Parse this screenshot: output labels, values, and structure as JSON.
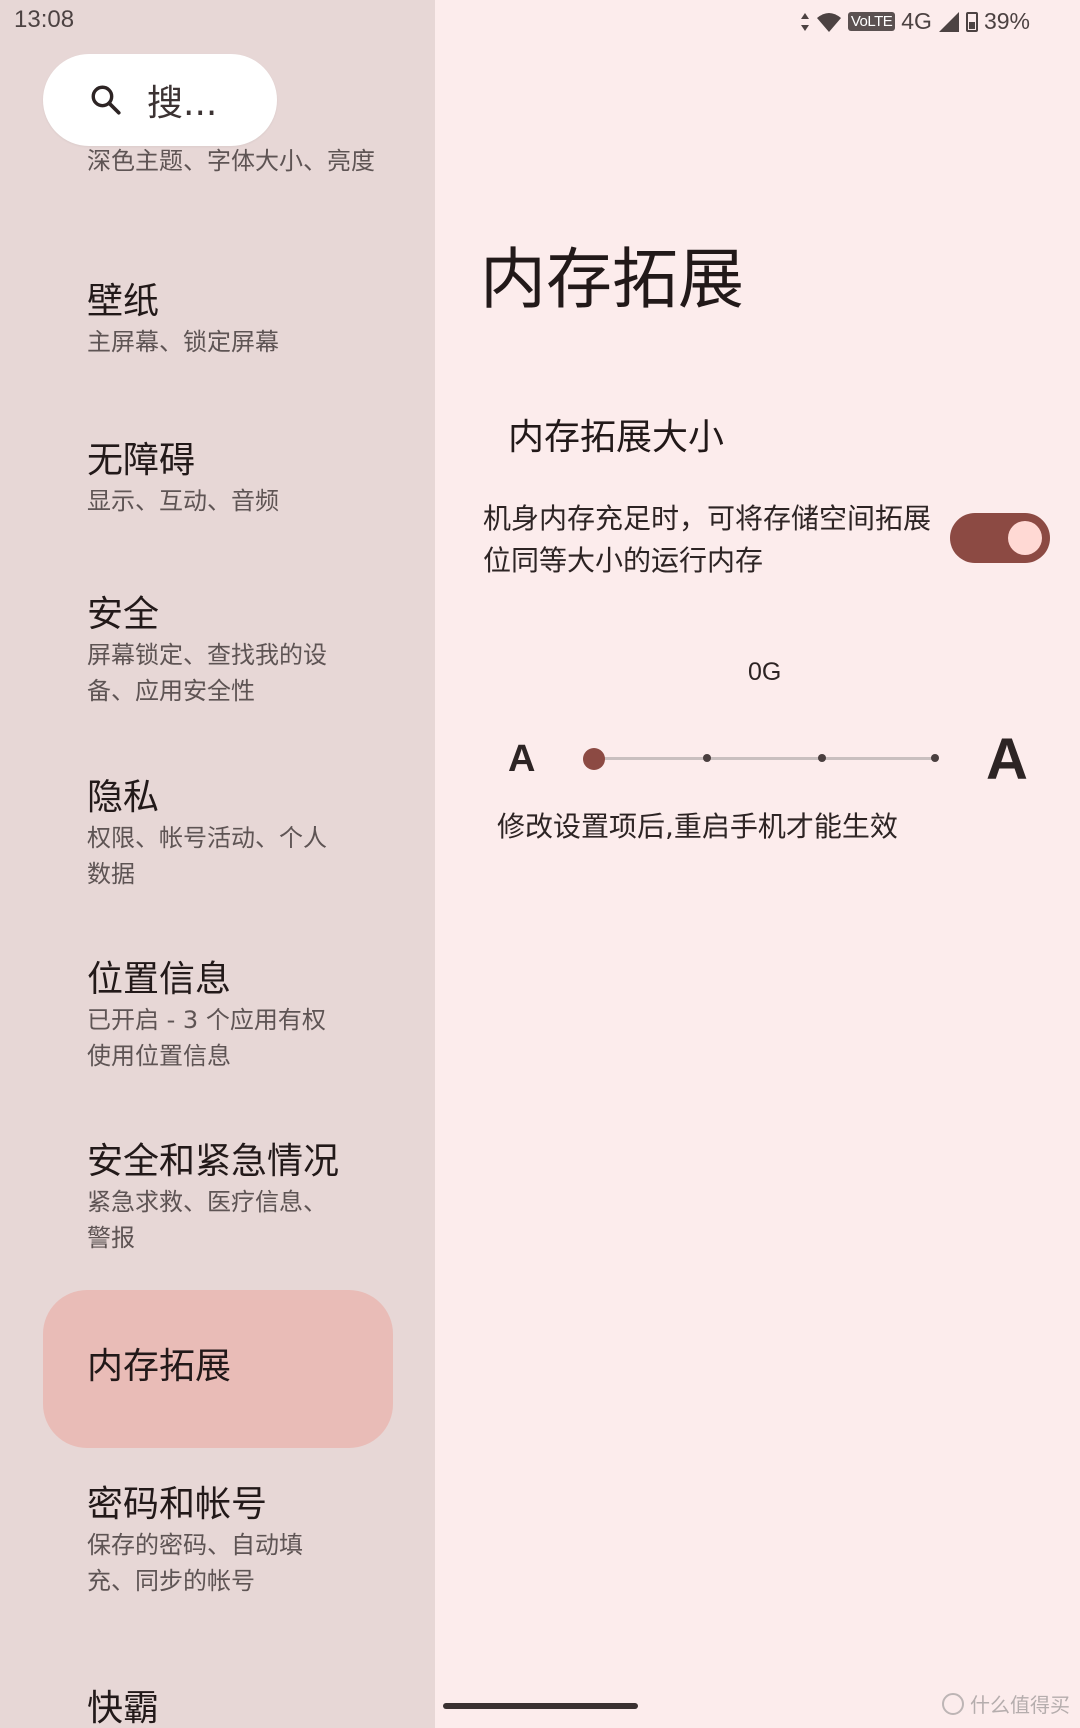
{
  "status_bar": {
    "time": "13:08",
    "network_label": "VoLTE",
    "network_type": "4G",
    "battery": "39%",
    "icons": [
      "data-arrows-icon",
      "wifi-icon",
      "signal-icon",
      "battery-icon"
    ]
  },
  "search": {
    "placeholder": "搜..."
  },
  "sidebar": {
    "partial_item": {
      "subtitle": "深色主题、字体大小、亮度"
    },
    "items": [
      {
        "title": "壁纸",
        "subtitle": "主屏幕、锁定屏幕"
      },
      {
        "title": "无障碍",
        "subtitle": "显示、互动、音频"
      },
      {
        "title": "安全",
        "subtitle": "屏幕锁定、查找我的设备、应用安全性"
      },
      {
        "title": "隐私",
        "subtitle": "权限、帐号活动、个人数据"
      },
      {
        "title": "位置信息",
        "subtitle": "已开启 - 3 个应用有权使用位置信息"
      },
      {
        "title": "安全和紧急情况",
        "subtitle": "紧急求救、医疗信息、警报"
      },
      {
        "title": "内存拓展",
        "subtitle": ""
      },
      {
        "title": "密码和帐号",
        "subtitle": "保存的密码、自动填充、同步的帐号"
      },
      {
        "title": "快霸",
        "subtitle": ""
      }
    ],
    "selected_index": 6
  },
  "main": {
    "title": "内存拓展",
    "section_title": "内存拓展大小",
    "description": "机身内存充足时，可将存储空间拓展位同等大小的运行内存",
    "toggle_on": true,
    "slider": {
      "value_label": "0G",
      "min_label": "A",
      "max_label": "A",
      "position": 0,
      "steps": 4
    },
    "hint": "修改设置项后,重启手机才能生效"
  },
  "colors": {
    "accent": "#8c4a43",
    "selected_bg": "#e9bcb7",
    "sidebar_bg": "#e7d7d6",
    "content_bg": "#fcecec"
  },
  "watermark": {
    "text": "什么值得买"
  }
}
